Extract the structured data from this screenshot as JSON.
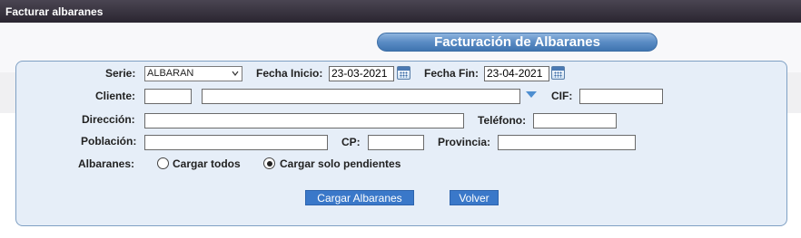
{
  "window": {
    "title": "Facturar albaranes"
  },
  "form": {
    "title": "Facturación de Albaranes"
  },
  "serie": {
    "label": "Serie:",
    "value": "ALBARAN"
  },
  "fecha_inicio": {
    "label": "Fecha Inicio:",
    "value": "23-03-2021"
  },
  "fecha_fin": {
    "label": "Fecha Fin:",
    "value": "23-04-2021"
  },
  "cliente": {
    "label": "Cliente:",
    "code": "",
    "name": ""
  },
  "cif": {
    "label": "CIF:",
    "value": ""
  },
  "direccion": {
    "label": "Dirección:",
    "value": ""
  },
  "telefono": {
    "label": "Teléfono:",
    "value": ""
  },
  "poblacion": {
    "label": "Población:",
    "value": ""
  },
  "cp": {
    "label": "CP:",
    "value": ""
  },
  "provincia": {
    "label": "Provincia:",
    "value": ""
  },
  "albaranes": {
    "label": "Albaranes:",
    "options": [
      {
        "label": "Cargar todos",
        "selected": false
      },
      {
        "label": "Cargar solo pendientes",
        "selected": true
      }
    ]
  },
  "buttons": {
    "cargar": "Cargar Albaranes",
    "volver": "Volver"
  },
  "colors": {
    "accent": "#3a78c9",
    "panel_bg": "#e6eef8",
    "titlebar": "#2f2a35"
  },
  "icons": [
    "calendar-icon",
    "chevron-down-icon",
    "dropdown-arrow-icon"
  ]
}
